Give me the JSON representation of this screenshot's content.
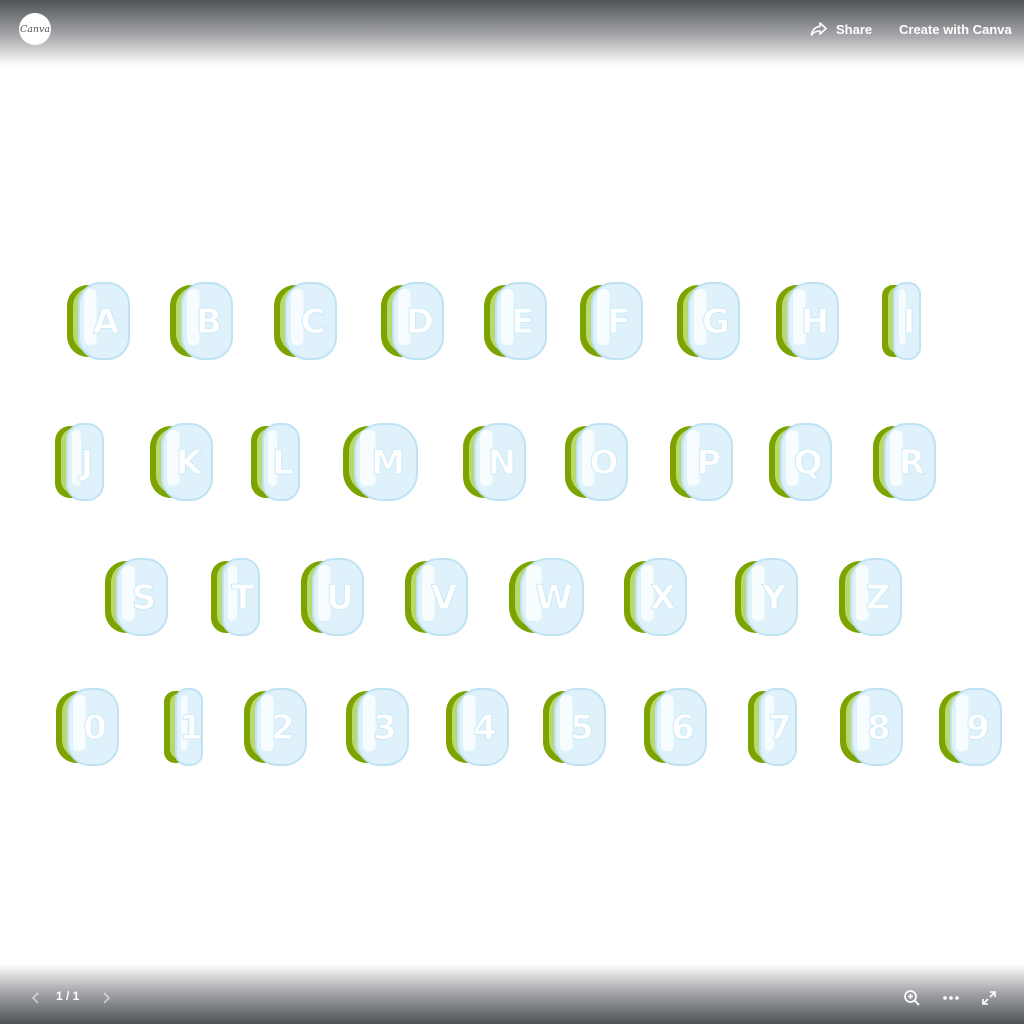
{
  "app": {
    "logo_text": "Canva"
  },
  "header": {
    "share_label": "Share",
    "create_label": "Create with Canva"
  },
  "footer": {
    "page_indicator": "1 / 1"
  },
  "icons": {
    "share": "share-arrow-icon",
    "prev": "chevron-left-icon",
    "next": "chevron-right-icon",
    "zoom": "zoom-in-icon",
    "more": "more-horizontal-icon",
    "fullscreen": "expand-icon"
  },
  "colors": {
    "letter_fill": "#dff2fb",
    "letter_outline": "#ffffff",
    "shadow_dark": "#7da300",
    "shadow_light": "#b9d96d"
  },
  "design": {
    "rows": [
      [
        "A",
        "B",
        "C",
        "D",
        "E",
        "F",
        "G",
        "H",
        "I"
      ],
      [
        "J",
        "K",
        "L",
        "M",
        "N",
        "O",
        "P",
        "Q",
        "R"
      ],
      [
        "S",
        "T",
        "U",
        "V",
        "W",
        "X",
        "Y",
        "Z"
      ],
      [
        "0",
        "1",
        "2",
        "3",
        "4",
        "5",
        "6",
        "7",
        "8",
        "9"
      ]
    ]
  }
}
